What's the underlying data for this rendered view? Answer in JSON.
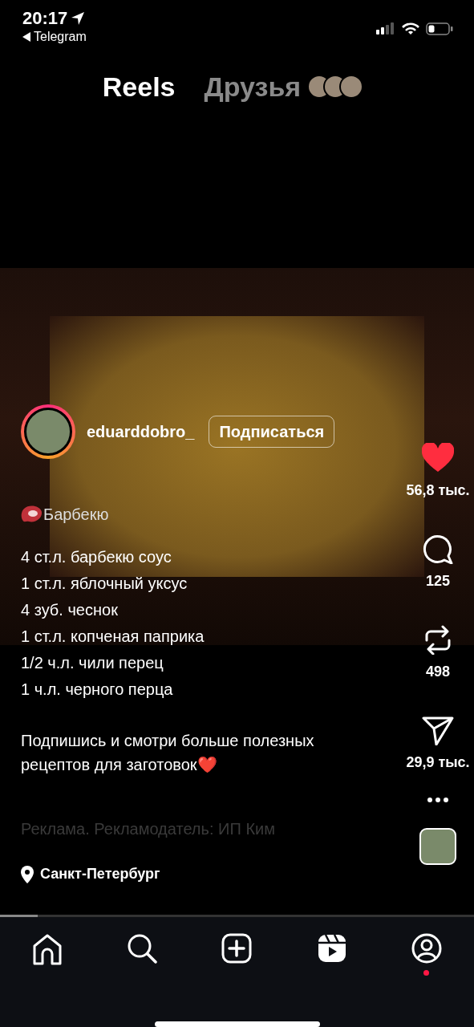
{
  "status_bar": {
    "time": "20:17",
    "back_app": "Telegram"
  },
  "tabs": [
    {
      "label": "Reels",
      "selected": true
    },
    {
      "label": "Друзья",
      "selected": false
    }
  ],
  "author": {
    "username": "eduarddobro_",
    "follow_button": "Подписаться"
  },
  "actions": [
    {
      "kind": "like",
      "count": "56,8 тыс.",
      "active": true
    },
    {
      "kind": "comment",
      "count": "125",
      "active": false
    },
    {
      "kind": "repost",
      "count": "498",
      "active": false
    },
    {
      "kind": "share",
      "count": "29,9 тыс.",
      "active": false
    }
  ],
  "caption": {
    "tag": "Барбекю",
    "ingredients": [
      "4 ст.л. барбекю соус",
      "1 ст.л. яблочный уксус",
      "4 зуб. чеснок",
      "1 ст.л. копченая паприка",
      "1/2 ч.л. чили перец",
      "1 ч.л. черного перца"
    ],
    "call_to_action": "Подпишись и смотри больше полезных рецептов для заготовок❤️",
    "ad_notice": "Реклама. Рекламодатель: ИП Ким"
  },
  "location": "Санкт-Петербург",
  "progress": {
    "level": 0.08
  },
  "nav": [
    {
      "kind": "home",
      "selected": false,
      "badge": false
    },
    {
      "kind": "search",
      "selected": false,
      "badge": false
    },
    {
      "kind": "create",
      "selected": false,
      "badge": false
    },
    {
      "kind": "reels",
      "selected": true,
      "badge": false
    },
    {
      "kind": "profile",
      "selected": false,
      "badge": true
    }
  ]
}
